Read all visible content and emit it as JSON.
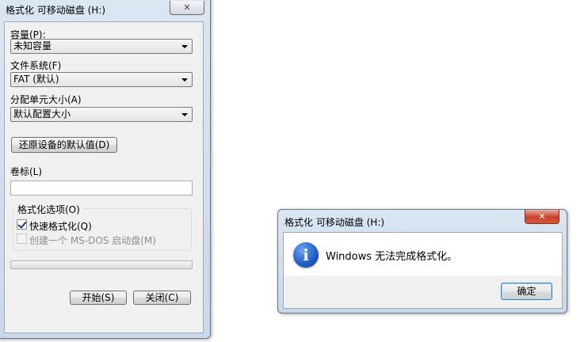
{
  "format_dialog": {
    "title": "格式化 可移动磁盘 (H:)",
    "close_glyph": "✕",
    "capacity_label": "容量(P):",
    "capacity_value": "未知容量",
    "filesystem_label": "文件系统(F)",
    "filesystem_value": "FAT (默认)",
    "alloc_label": "分配单元大小(A)",
    "alloc_value": "默认配置大小",
    "restore_button": "还原设备的默认值(D)",
    "volume_label": "卷标(L)",
    "volume_value": "",
    "options_group_label": "格式化选项(O)",
    "quick_format_label": "快速格式化(Q)",
    "quick_format_checked": true,
    "msdos_label": "创建一个 MS-DOS 启动盘(M)",
    "msdos_checked": false,
    "progress": 0,
    "start_button": "开始(S)",
    "close_button": "关闭(C)"
  },
  "message_box": {
    "title": "格式化 可移动磁盘 (H:)",
    "close_glyph": "✕",
    "icon_glyph": "i",
    "message": "Windows 无法完成格式化。",
    "ok_button": "确定"
  }
}
